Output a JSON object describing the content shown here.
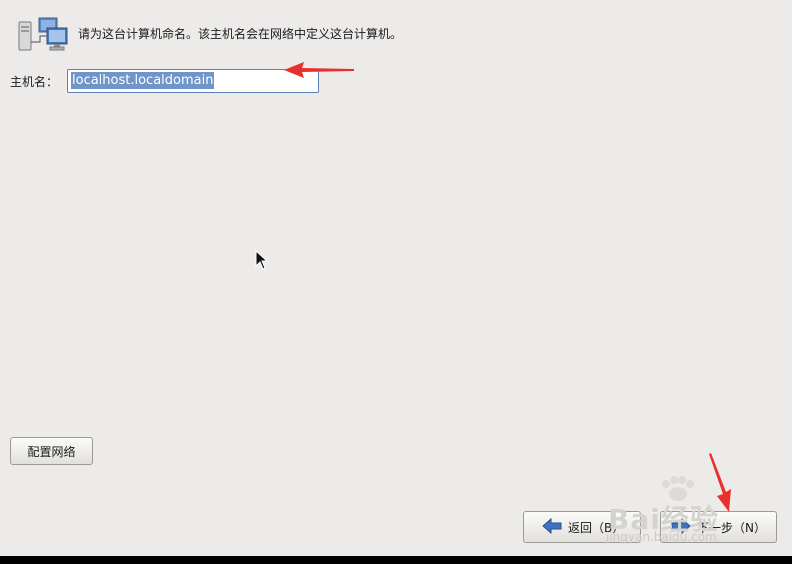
{
  "header": {
    "icon": "network-computers-icon",
    "text": "请为这台计算机命名。该主机名会在网络中定义这台计算机。"
  },
  "hostname": {
    "label": "主机名：",
    "value": "localhost.localdomain"
  },
  "buttons": {
    "configure_network": "配置网络",
    "back": "返回（B）",
    "next": "下一步（N）"
  },
  "annotations": {
    "arrow_color": "#e8302c"
  },
  "watermark": {
    "brand": "Bai经验",
    "url": "jingyan.baidu.com"
  }
}
